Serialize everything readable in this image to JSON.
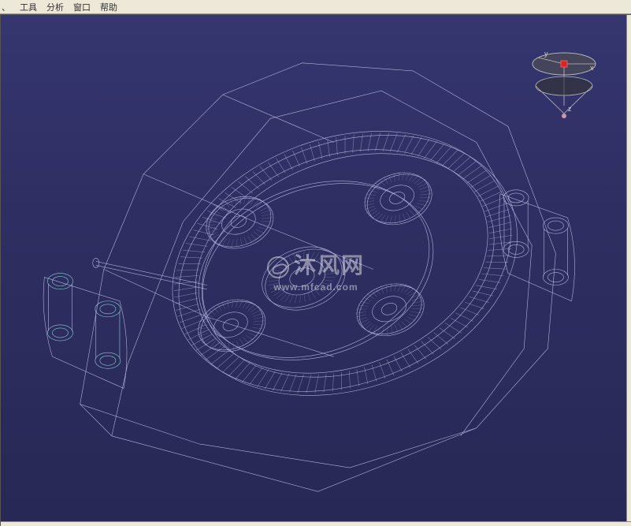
{
  "menubar": {
    "items": [
      "工具",
      "分析",
      "窗口",
      "帮助"
    ]
  },
  "compass": {
    "axis_x": "x",
    "axis_y": "y",
    "axis_z": "z"
  },
  "watermark": {
    "brand": "沐风网",
    "url": "www.mfcad.com"
  },
  "viewport": {
    "render_mode": "wireframe",
    "model_desc": "planetary-gear-assembly"
  }
}
